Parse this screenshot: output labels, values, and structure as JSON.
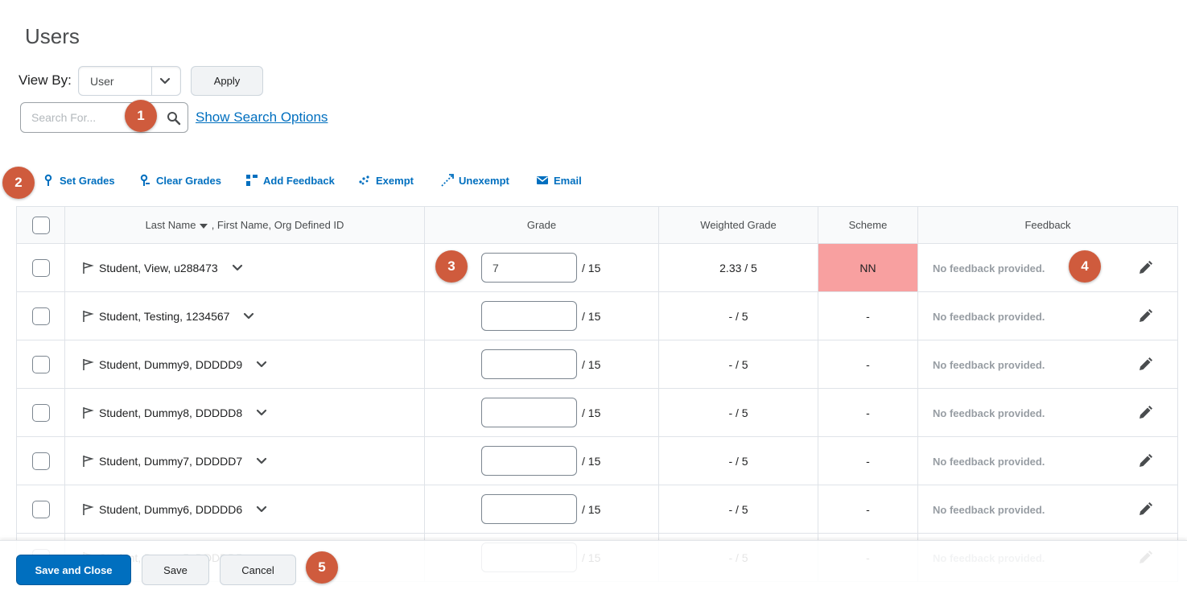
{
  "page": {
    "title": "Users"
  },
  "view_by": {
    "label": "View By:",
    "selected": "User",
    "apply_label": "Apply"
  },
  "search": {
    "placeholder": "Search For...",
    "show_options_label": "Show Search Options"
  },
  "markers": [
    "1",
    "2",
    "3",
    "4",
    "5"
  ],
  "toolbar": [
    {
      "label": "Set Grades",
      "icon": "set-grades-icon"
    },
    {
      "label": "Clear Grades",
      "icon": "clear-grades-icon"
    },
    {
      "label": "Add Feedback",
      "icon": "add-feedback-icon"
    },
    {
      "label": "Exempt",
      "icon": "exempt-icon"
    },
    {
      "label": "Unexempt",
      "icon": "unexempt-icon"
    },
    {
      "label": "Email",
      "icon": "email-icon"
    }
  ],
  "table": {
    "headers": {
      "name": "Last Name",
      "name_rest": ", First Name, Org Defined ID",
      "grade": "Grade",
      "weighted": "Weighted Grade",
      "scheme": "Scheme",
      "feedback": "Feedback"
    },
    "rows": [
      {
        "name": "Student, View, u288473",
        "grade": "7",
        "grade_max": "/ 15",
        "weighted": "2.33 / 5",
        "scheme": "NN",
        "feedback": "No feedback provided."
      },
      {
        "name": "Student, Testing, 1234567",
        "grade": "",
        "grade_max": "/ 15",
        "weighted": "- / 5",
        "scheme": "-",
        "feedback": "No feedback provided."
      },
      {
        "name": "Student, Dummy9, DDDDD9",
        "grade": "",
        "grade_max": "/ 15",
        "weighted": "- / 5",
        "scheme": "-",
        "feedback": "No feedback provided."
      },
      {
        "name": "Student, Dummy8, DDDDD8",
        "grade": "",
        "grade_max": "/ 15",
        "weighted": "- / 5",
        "scheme": "-",
        "feedback": "No feedback provided."
      },
      {
        "name": "Student, Dummy7, DDDDD7",
        "grade": "",
        "grade_max": "/ 15",
        "weighted": "- / 5",
        "scheme": "-",
        "feedback": "No feedback provided."
      },
      {
        "name": "Student, Dummy6, DDDDD6",
        "grade": "",
        "grade_max": "/ 15",
        "weighted": "- / 5",
        "scheme": "-",
        "feedback": "No feedback provided."
      },
      {
        "name": "Student, Dummy5, DDDDD5",
        "grade": "",
        "grade_max": "/ 15",
        "weighted": "- / 5",
        "scheme": "-",
        "feedback": "No feedback provided."
      }
    ]
  },
  "footer": {
    "save_close_label": "Save and Close",
    "save_label": "Save",
    "cancel_label": "Cancel"
  },
  "colors": {
    "accent": "#006fbf",
    "marker": "#cf5b3d",
    "scheme_nn": "#f8a0a0"
  }
}
